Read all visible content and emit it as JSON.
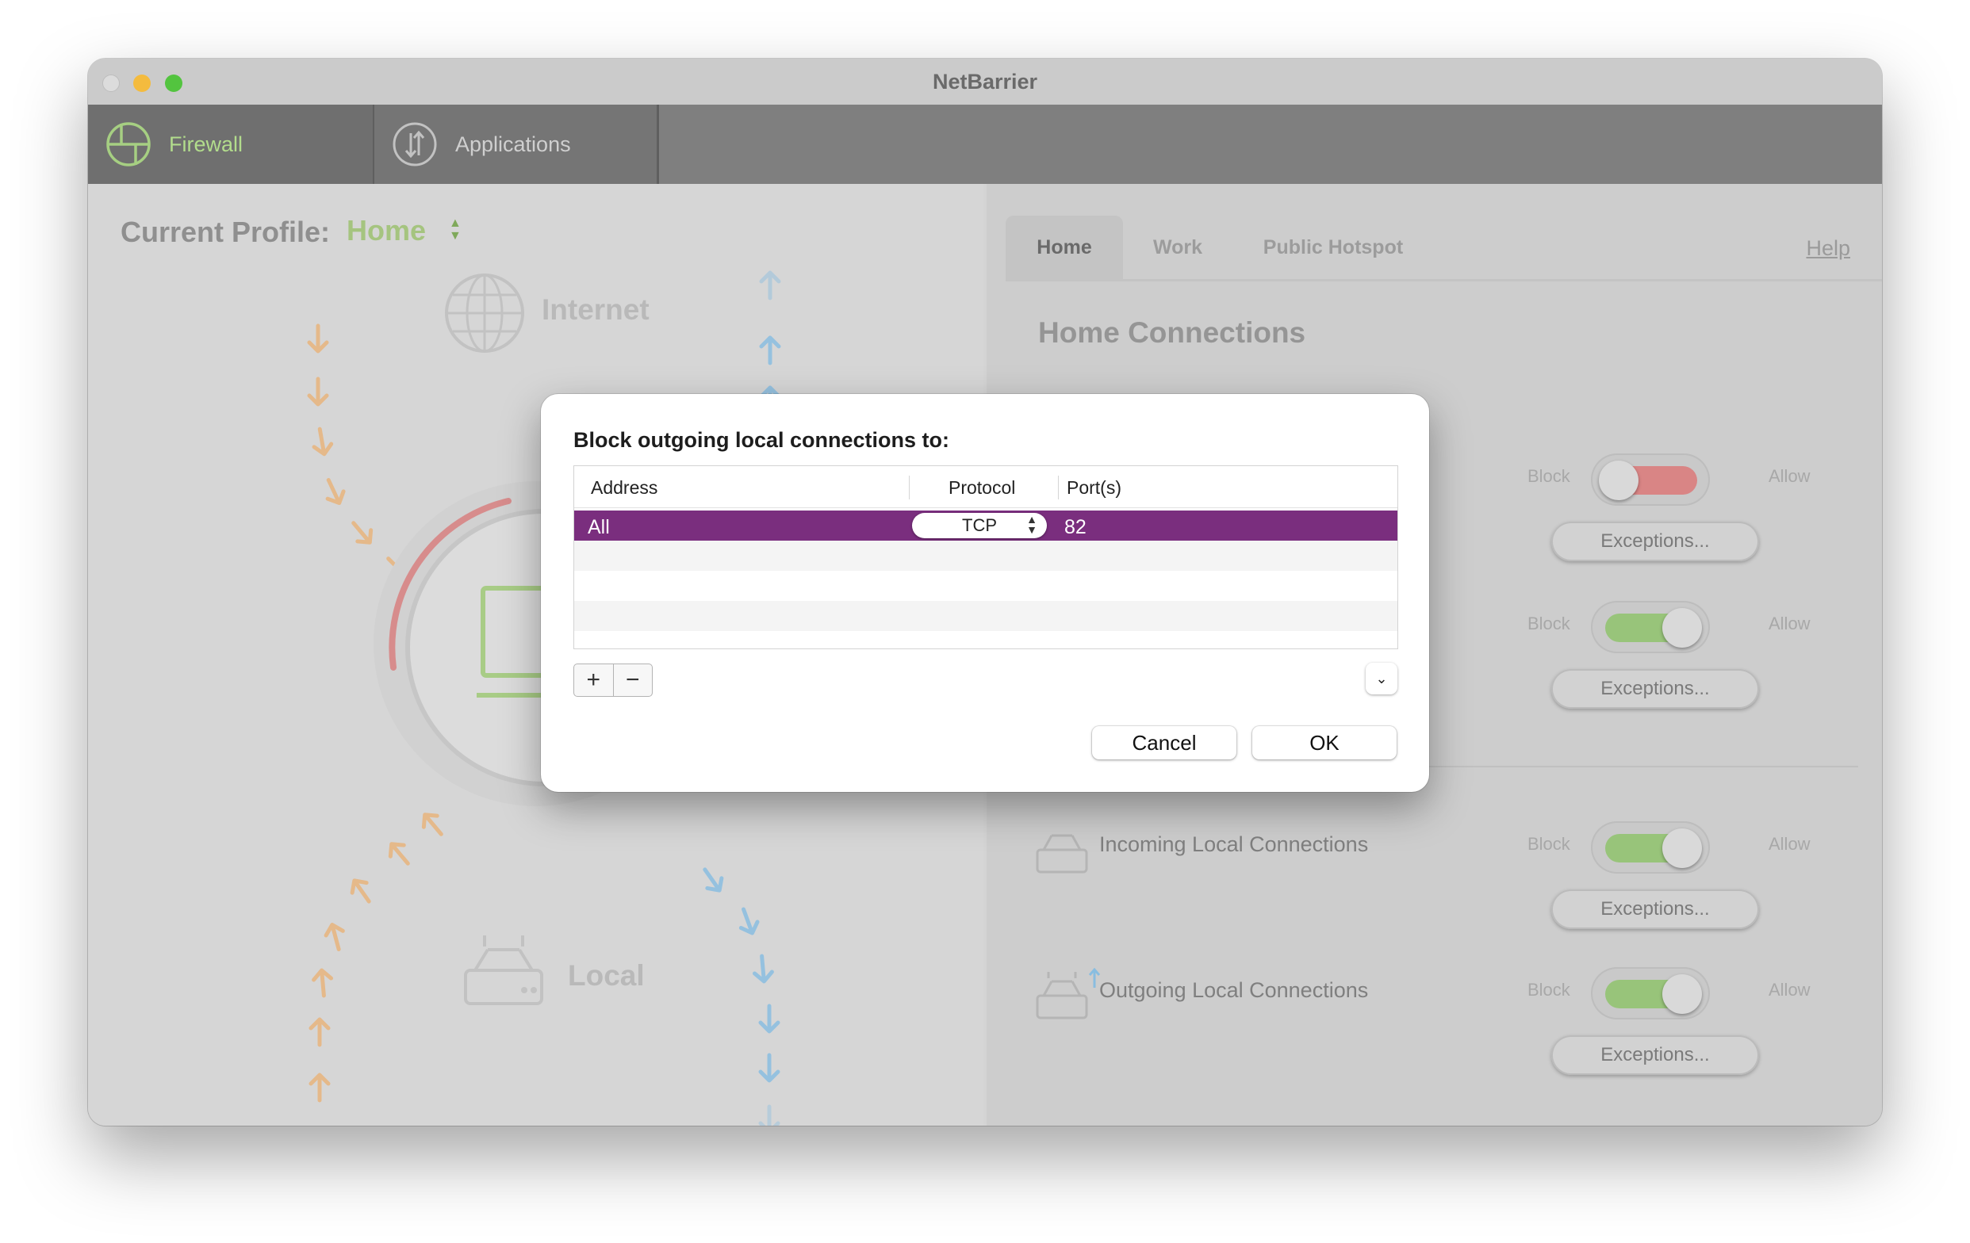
{
  "window": {
    "title": "NetBarrier"
  },
  "toolbar": {
    "tabs": [
      {
        "label": "Firewall",
        "icon": "firewall-icon"
      },
      {
        "label": "Applications",
        "icon": "applications-icon"
      }
    ]
  },
  "left": {
    "profile_label": "Current Profile:",
    "profile_value": "Home",
    "internet_label": "Internet",
    "local_label": "Local"
  },
  "right": {
    "tabs": [
      {
        "label": "Home"
      },
      {
        "label": "Work"
      },
      {
        "label": "Public Hotspot"
      }
    ],
    "help": "Help",
    "section_title": "Home Connections",
    "block_label": "Block",
    "allow_label": "Allow",
    "exceptions_label": "Exceptions...",
    "rows": [
      {
        "label": "",
        "state": "block"
      },
      {
        "label": "",
        "state": "allow"
      },
      {
        "label": "Incoming Local Connections",
        "state": "allow"
      },
      {
        "label": "Outgoing Local Connections",
        "state": "allow"
      }
    ]
  },
  "dialog": {
    "title": "Block outgoing local connections to:",
    "columns": {
      "address": "Address",
      "protocol": "Protocol",
      "ports": "Port(s)"
    },
    "rows": [
      {
        "address": "All",
        "protocol": "TCP",
        "ports": "82"
      }
    ],
    "add_label": "+",
    "remove_label": "−",
    "cancel_label": "Cancel",
    "ok_label": "OK"
  },
  "colors": {
    "selection": "#7a2e7e",
    "toggle_on": "#98c47a",
    "toggle_off": "#d98585",
    "arrow_in": "#e8b177",
    "arrow_out": "#89bde0"
  }
}
